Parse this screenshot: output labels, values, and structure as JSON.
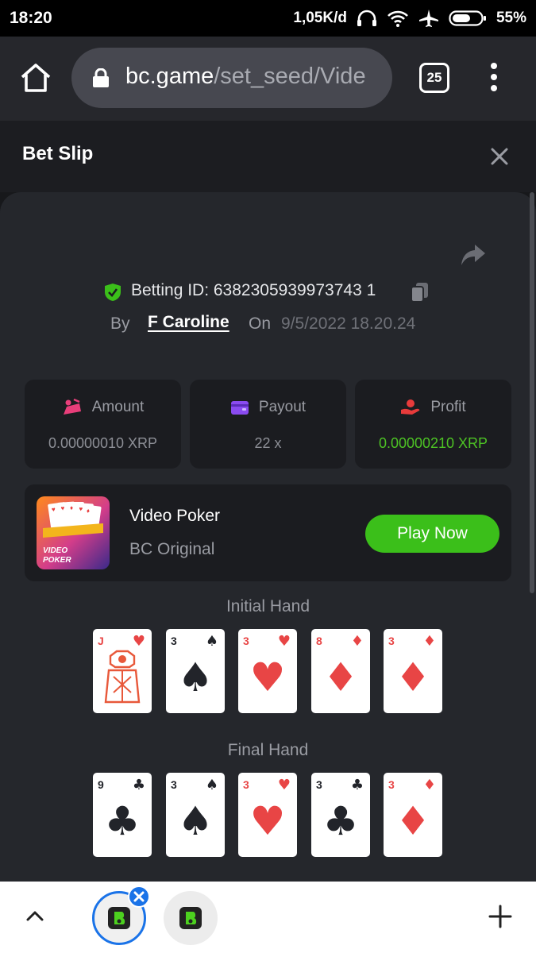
{
  "status": {
    "time": "18:20",
    "speed": "1,05K/d",
    "battery": "55%"
  },
  "browser": {
    "url_host": "bc.game",
    "url_path": "/set_seed/Vide",
    "tab_count": "25"
  },
  "slip": {
    "title": "Bet Slip"
  },
  "bet": {
    "betting_id_label": "Betting ID: 6382305939973743 1",
    "by_label": "By",
    "user": "F Caroline",
    "on_label": "On",
    "date": "9/5/2022 18.20.24"
  },
  "stats": {
    "amount": {
      "label": "Amount",
      "value": "0.00000010 XRP"
    },
    "payout": {
      "label": "Payout",
      "value": "22 x"
    },
    "profit": {
      "label": "Profit",
      "value": "0.00000210 XRP"
    }
  },
  "game": {
    "thumb_text": "VIDEO POKER",
    "name": "Video Poker",
    "subtitle": "BC Original",
    "play_label": "Play Now"
  },
  "initial_hand": {
    "title": "Initial Hand",
    "cards": [
      {
        "rank": "J",
        "suit": "heart"
      },
      {
        "rank": "3",
        "suit": "spade"
      },
      {
        "rank": "3",
        "suit": "heart"
      },
      {
        "rank": "8",
        "suit": "diamond"
      },
      {
        "rank": "3",
        "suit": "diamond"
      }
    ]
  },
  "final_hand": {
    "title": "Final Hand",
    "cards": [
      {
        "rank": "9",
        "suit": "club"
      },
      {
        "rank": "3",
        "suit": "spade"
      },
      {
        "rank": "3",
        "suit": "heart"
      },
      {
        "rank": "3",
        "suit": "club"
      },
      {
        "rank": "3",
        "suit": "diamond"
      }
    ]
  },
  "colors": {
    "profit_green": "#4dc224",
    "play_green": "#3bbf1a",
    "chrome_blue": "#1a73e8"
  }
}
